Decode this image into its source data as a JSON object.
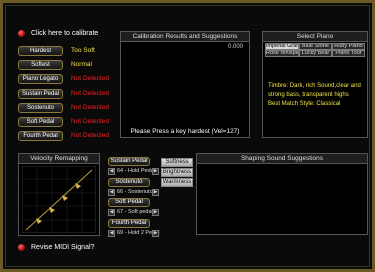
{
  "calibrate_label": "Click here to calibrate",
  "calibration_rows": [
    {
      "button": "Hardest",
      "status": "Too Soft",
      "status_color": "yellow"
    },
    {
      "button": "Softest",
      "status": "Normal",
      "status_color": "yellow"
    },
    {
      "button": "Piano Legato",
      "status": "Not Detected",
      "status_color": "red"
    },
    {
      "button": "Sustain Pedal",
      "status": "Not Detected",
      "status_color": "red"
    },
    {
      "button": "Sostenuto",
      "status": "Not Detected",
      "status_color": "red"
    },
    {
      "button": "Soft Pedal",
      "status": "Not Detected",
      "status_color": "red"
    },
    {
      "button": "Fourth Pedal",
      "status": "Not Detected",
      "status_color": "red"
    }
  ],
  "calibration_panel": {
    "title": "Calibration Results and Suggestions",
    "value": "0.000",
    "prompt": "Please Press a key hardest (Vel=127)"
  },
  "select_piano": {
    "title": "Select Piano",
    "options": [
      [
        "Imperial Grand",
        "Blue Stone",
        "Ruby Piano"
      ],
      [
        "Rose Whisper",
        "Lucky Bear",
        "Piano Tour"
      ]
    ],
    "selected": "Imperial Grand",
    "description_1": "Timbre: Dark, rich Sound,clear and",
    "description_2": "strong bass, transparent highs",
    "description_3": "Best Match Style: Classical"
  },
  "velocity": {
    "title": "Velocity Remapping"
  },
  "pedal_controls": [
    {
      "button": "Sustain Pedal",
      "dropdown": "64 - Hold Pedal"
    },
    {
      "button": "Sostenuto",
      "dropdown": "66 - Sostenuto"
    },
    {
      "button": "Soft Pedal",
      "dropdown": "67 - Soft pedal"
    },
    {
      "button": "Fourth Pedal",
      "dropdown": "69 - Hold 2 Pedal"
    }
  ],
  "tone_buttons": [
    "Softness",
    "Brightness",
    "Warmness"
  ],
  "shaping_panel": {
    "title": "Shaping Sound Suggestions"
  },
  "revise_label": "Revise MIDI Signal?",
  "colors": {
    "accent_border": "#6b5a24",
    "button_border": "#8c7a3a",
    "yellow": "#f3e24a",
    "red": "#ee2222"
  }
}
